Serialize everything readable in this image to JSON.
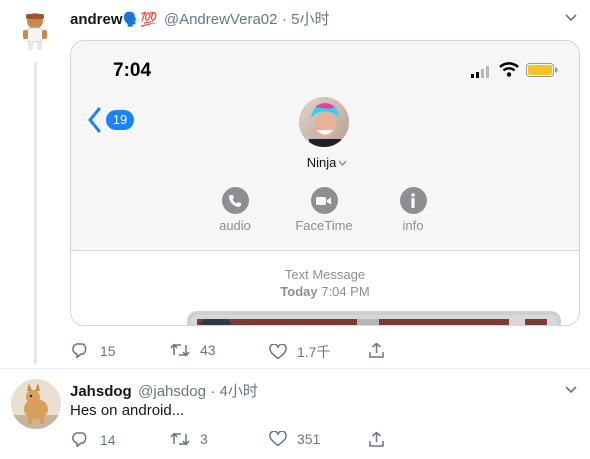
{
  "tweet": {
    "display_name": "andrew",
    "name_emoji": "🗣️💯",
    "handle": "@AndrewVera02",
    "time": "· 5小时",
    "stats": {
      "replies": "15",
      "retweets": "43",
      "likes": "1.7千"
    }
  },
  "card": {
    "status_time": "7:04",
    "back_count": "19",
    "contact_name": "Ninja",
    "actions": [
      {
        "label": "audio",
        "icon": "phone-icon"
      },
      {
        "label": "FaceTime",
        "icon": "video-icon"
      },
      {
        "label": "info",
        "icon": "info-icon"
      }
    ],
    "message_type": "Text Message",
    "message_day": "Today",
    "message_time": "7:04 PM"
  },
  "reply": {
    "display_name": "Jahsdog",
    "handle": "@jahsdog",
    "time": "· 4小时",
    "text": "Hes on android...",
    "stats": {
      "replies": "14",
      "retweets": "3",
      "likes": "351"
    }
  },
  "colors": {
    "accent": "#1da1f2",
    "muted": "#657786",
    "border": "#e1e8ed"
  }
}
